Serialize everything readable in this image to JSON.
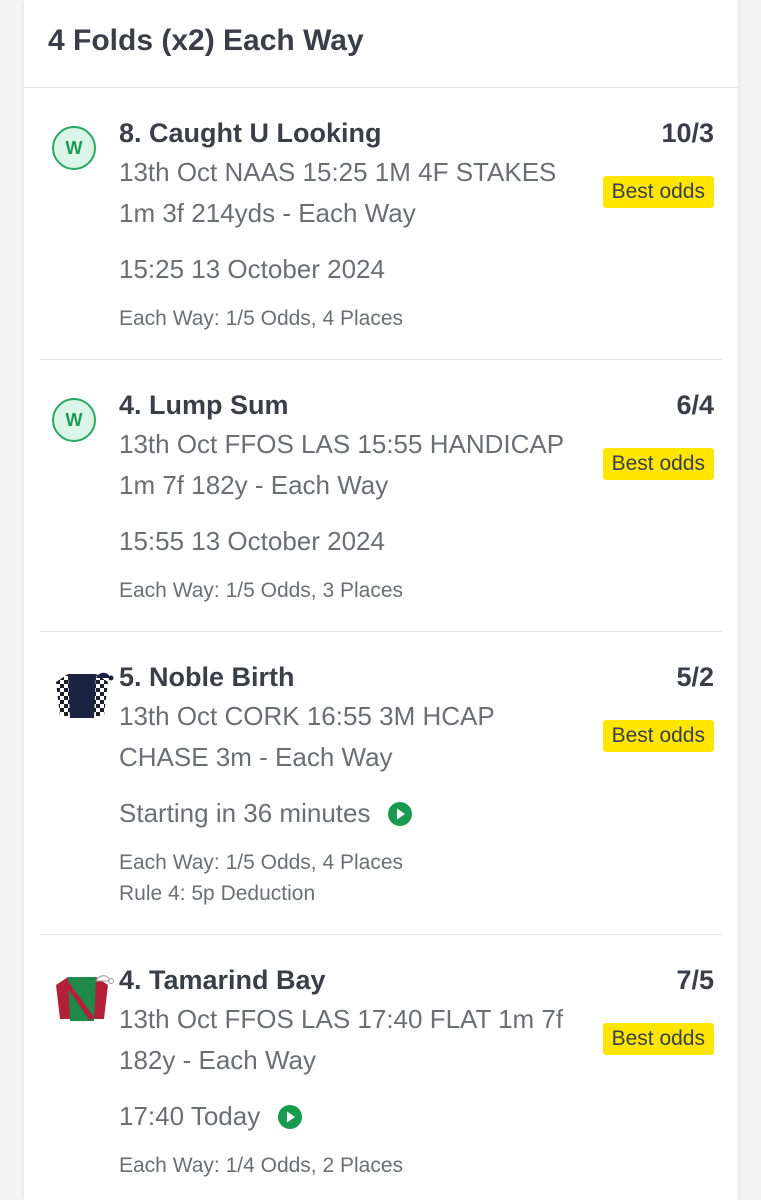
{
  "header": {
    "title": "4 Folds (x2) Each Way"
  },
  "selections": [
    {
      "name": "8. Caught U Looking",
      "price": "10/3",
      "event": "13th Oct NAAS 15:25 1M 4F STAKES 1m 3f 214yds - Each Way",
      "badge": "Best odds",
      "time": "15:25 13 October 2024",
      "terms": "Each Way: 1/5 Odds, 4 Places",
      "icon": "won-badge-icon",
      "icon_text": "W"
    },
    {
      "name": "4. Lump Sum",
      "price": "6/4",
      "event": "13th Oct FFOS LAS 15:55 HANDICAP 1m 7f 182y - Each Way",
      "badge": "Best odds",
      "time": "15:55 13 October 2024",
      "terms": "Each Way: 1/5 Odds, 3 Places",
      "icon": "won-badge-icon",
      "icon_text": "W"
    },
    {
      "name": "5. Noble Birth",
      "price": "5/2",
      "event": "13th Oct CORK 16:55 3M HCAP CHASE 3m - Each Way",
      "badge": "Best odds",
      "time": "Starting in 36 minutes",
      "terms": "Each Way: 1/5 Odds, 4 Places",
      "terms2": "Rule 4: 5p Deduction",
      "icon": "jockey-silks-icon"
    },
    {
      "name": "4. Tamarind Bay",
      "price": "7/5",
      "event": "13th Oct FFOS LAS 17:40 FLAT 1m 7f 182y - Each Way",
      "badge": "Best odds",
      "time": "17:40 Today",
      "terms": "Each Way: 1/4 Odds, 2 Places",
      "icon": "jockey-silks-icon"
    }
  ],
  "colors": {
    "badge_bg": "#ffe600",
    "won_green": "#2aa864",
    "play_green": "#1a9a4f"
  }
}
